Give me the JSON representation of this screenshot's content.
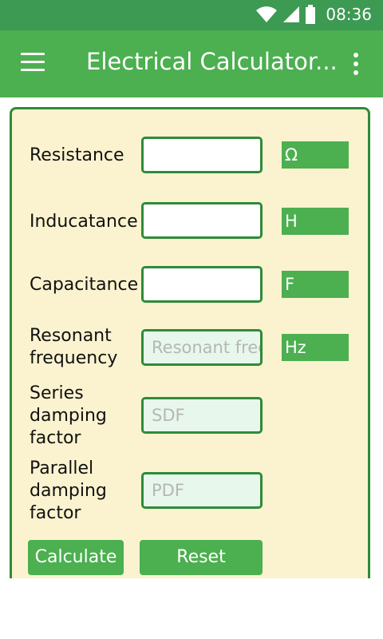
{
  "status": {
    "time": "08:36",
    "icons": [
      "wifi-icon",
      "cell-signal-icon",
      "battery-icon"
    ]
  },
  "appbar": {
    "title": "Electrical Calculator..."
  },
  "form": {
    "resistance": {
      "label": "Resistance",
      "value": "",
      "unit": "Ω"
    },
    "inductance": {
      "label": "Inducatance",
      "value": "",
      "unit": "H"
    },
    "capacitance": {
      "label": "Capacitance",
      "value": "",
      "unit": "F"
    },
    "resonant": {
      "label_line1": "Resonant",
      "label_line2": "frequency",
      "placeholder": "Resonant frec",
      "unit": "Hz"
    },
    "series": {
      "label_line1": "Series",
      "label_line2": "damping",
      "label_line3": "factor",
      "placeholder": "SDF"
    },
    "parallel": {
      "label_line1": "Parallel",
      "label_line2": "damping",
      "label_line3": "factor",
      "placeholder": "PDF"
    }
  },
  "buttons": {
    "calculate": "Calculate",
    "reset": "Reset"
  },
  "colors": {
    "status_bar": "#3d9a52",
    "app_bar": "#4caf50",
    "card_bg": "#fbf3cf",
    "border": "#2e8b39"
  }
}
